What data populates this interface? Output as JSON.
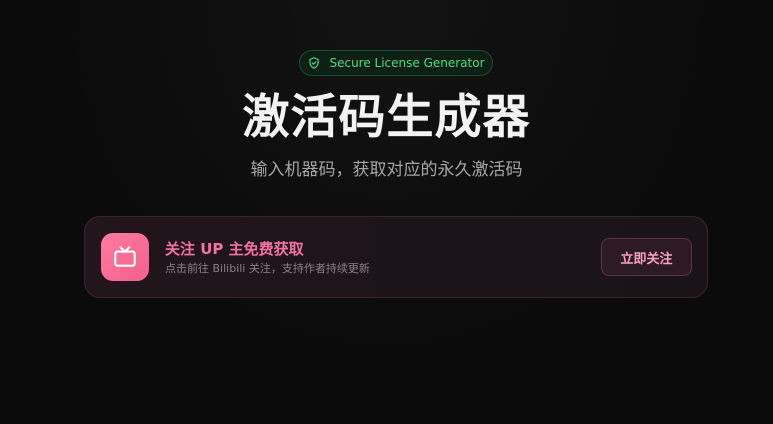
{
  "badge": {
    "icon": "shield-check-icon",
    "label": "Secure License Generator",
    "color": "#4ade80"
  },
  "header": {
    "title": "激活码生成器",
    "subtitle": "输入机器码，获取对应的永久激活码"
  },
  "promo": {
    "icon": "tv-icon",
    "title": "关注 UP 主免费获取",
    "description": "点击前往 Bilibili 关注，支持作者持续更新",
    "button_label": "立即关注",
    "accent": "#f472a0"
  }
}
